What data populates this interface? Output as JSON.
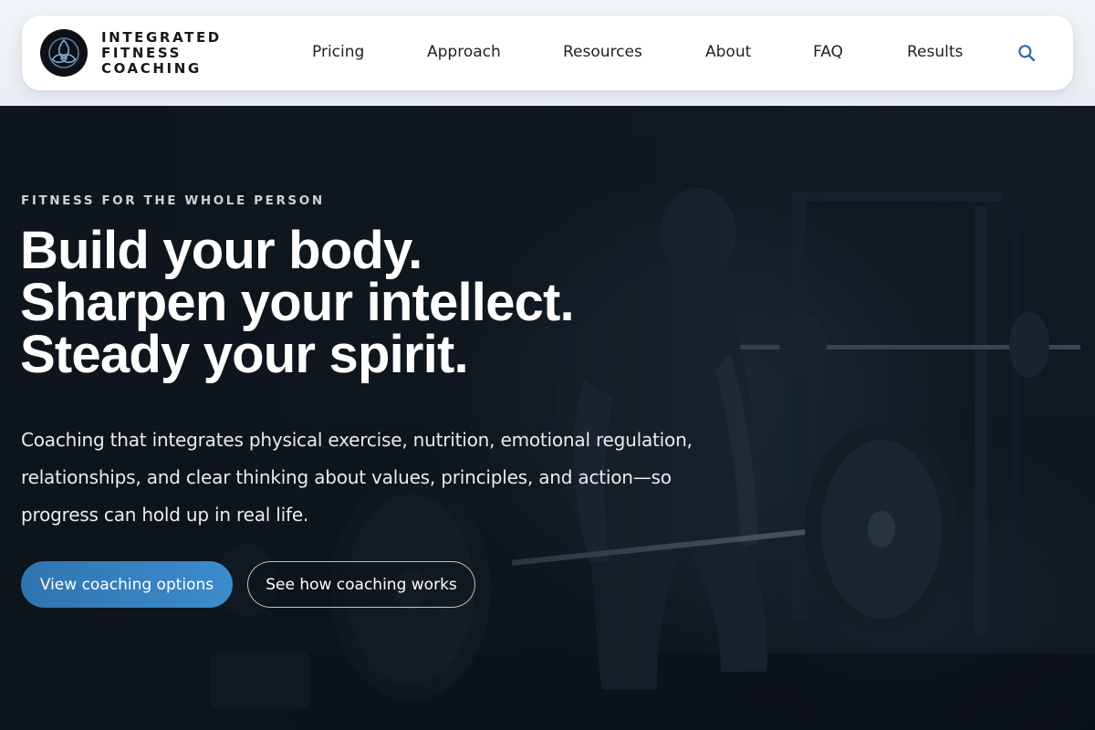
{
  "brand": {
    "name_lines": [
      "INTEGRATED",
      "FITNESS",
      "COACHING"
    ],
    "logo_icon": "triquetra-logo-icon"
  },
  "nav": {
    "items": [
      {
        "label": "Pricing"
      },
      {
        "label": "Approach"
      },
      {
        "label": "Resources"
      },
      {
        "label": "About"
      },
      {
        "label": "FAQ"
      },
      {
        "label": "Results"
      }
    ],
    "search_icon": "search-icon"
  },
  "hero": {
    "eyebrow": "FITNESS FOR THE WHOLE PERSON",
    "headline_lines": [
      "Build your body.",
      "Sharpen your intellect.",
      "Steady your spirit."
    ],
    "lede": "Coaching that integrates physical exercise, nutrition, emotional regulation, relationships, and clear thinking about values, principles, and action—so progress can hold up in real life.",
    "primary_cta": "View coaching options",
    "secondary_cta": "See how coaching works",
    "background_image": "dimly lit gym weightlifter"
  },
  "colors": {
    "accent": "#3a86c6",
    "hero_bg": "#101821",
    "header_bg": "#ffffff",
    "nav_text": "#1c2128"
  }
}
